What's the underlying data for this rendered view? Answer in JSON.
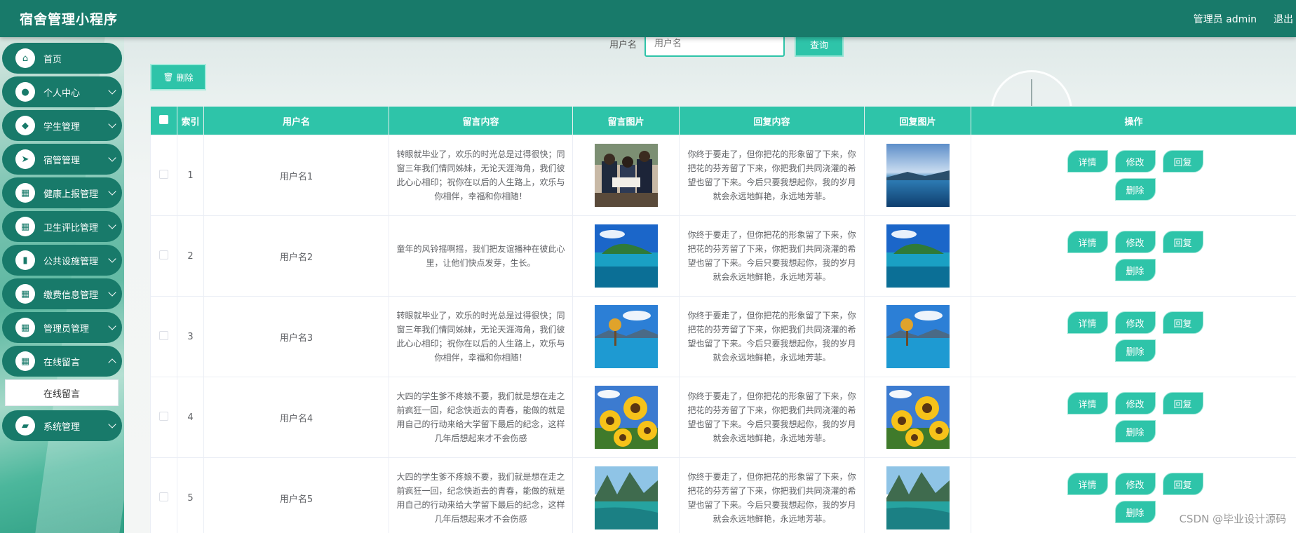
{
  "app": {
    "title": "宿舍管理小程序"
  },
  "topbar": {
    "user": "管理员 admin",
    "logout": "退出"
  },
  "sidebar": {
    "items": [
      {
        "label": "首页",
        "icon": "home-icon",
        "glyph": "⌂",
        "expandable": false
      },
      {
        "label": "个人中心",
        "icon": "user-icon",
        "glyph": "●",
        "expandable": true
      },
      {
        "label": "学生管理",
        "icon": "student-icon",
        "glyph": "◆",
        "expandable": true
      },
      {
        "label": "宿管管理",
        "icon": "send-icon",
        "glyph": "➤",
        "expandable": true
      },
      {
        "label": "健康上报管理",
        "icon": "grid-icon",
        "glyph": "▦",
        "expandable": true
      },
      {
        "label": "卫生评比管理",
        "icon": "grid-icon",
        "glyph": "▦",
        "expandable": true
      },
      {
        "label": "公共设施管理",
        "icon": "book-icon",
        "glyph": "▮",
        "expandable": true
      },
      {
        "label": "缴费信息管理",
        "icon": "grid-icon",
        "glyph": "▦",
        "expandable": true
      },
      {
        "label": "管理员管理",
        "icon": "grid-icon",
        "glyph": "▦",
        "expandable": true
      },
      {
        "label": "在线留言",
        "icon": "grid-icon",
        "glyph": "▦",
        "expandable": true,
        "open": true
      },
      {
        "label": "系统管理",
        "icon": "wallet-icon",
        "glyph": "▰",
        "expandable": true
      }
    ],
    "sub_item": "在线留言"
  },
  "search": {
    "label": "用户名",
    "placeholder": "用户名",
    "button": "查询"
  },
  "toolbar": {
    "delete_label": "删除",
    "delete_icon": "trash-icon"
  },
  "table": {
    "headers": [
      "",
      "索引",
      "用户名",
      "留言内容",
      "留言图片",
      "回复内容",
      "回复图片",
      "操作"
    ],
    "rows": [
      {
        "index": "1",
        "username": "用户名1",
        "message": "转眼就毕业了，欢乐的时光总是过得很快；同窗三年我们情同姊妹，无论天涯海角，我们彼此心心相印；祝你在以后的人生路上，欢乐与你相伴，幸福和你相随！",
        "message_image": "students-reading",
        "reply": "你终于要走了，但你把花的形象留了下来，你把花的芬芳留了下来，你把我们共同浇灌的希望也留了下来。今后只要我想起你，我的岁月就会永远地鲜艳，永远地芳菲。",
        "reply_image": "lake-sky"
      },
      {
        "index": "2",
        "username": "用户名2",
        "message": "童年的风铃摇啊摇，我们把友谊播种在彼此心里，让他们快点发芽，生长。",
        "message_image": "island-lake",
        "reply": "你终于要走了，但你把花的形象留了下来，你把花的芬芳留了下来，你把我们共同浇灌的希望也留了下来。今后只要我想起你，我的岁月就会永远地鲜艳，永远地芳菲。",
        "reply_image": "island-lake"
      },
      {
        "index": "3",
        "username": "用户名3",
        "message": "转眼就毕业了，欢乐的时光总是过得很快；同窗三年我们情同姊妹，无论天涯海角，我们彼此心心相印；祝你在以后的人生路上，欢乐与你相伴，幸福和你相随！",
        "message_image": "tree-lake",
        "reply": "你终于要走了，但你把花的形象留了下来，你把花的芬芳留了下来，你把我们共同浇灌的希望也留了下来。今后只要我想起你，我的岁月就会永远地鲜艳，永远地芳菲。",
        "reply_image": "tree-lake"
      },
      {
        "index": "4",
        "username": "用户名4",
        "message": "大四的学生爹不疼娘不要，我们就是想在走之前疯狂一回，纪念快逝去的青春，能做的就是用自己的行动来给大学留下最后的纪念，这样几年后想起来才不会伤感",
        "message_image": "sunflowers",
        "reply": "你终于要走了，但你把花的形象留了下来，你把花的芬芳留了下来，你把我们共同浇灌的希望也留了下来。今后只要我想起你，我的岁月就会永远地鲜艳，永远地芳菲。",
        "reply_image": "sunflowers"
      },
      {
        "index": "5",
        "username": "用户名5",
        "message": "大四的学生爹不疼娘不要，我们就是想在走之前疯狂一回，纪念快逝去的青春，能做的就是用自己的行动来给大学留下最后的纪念，这样几年后想起来才不会伤感",
        "message_image": "mountain-river",
        "reply": "你终于要走了，但你把花的形象留了下来，你把花的芬芳留了下来，你把我们共同浇灌的希望也留了下来。今后只要我想起你，我的岁月就会永远地鲜艳，永远地芳菲。",
        "reply_image": "mountain-river"
      }
    ],
    "actions": [
      "详情",
      "修改",
      "回复",
      "删除"
    ]
  },
  "watermark": "CSDN @毕业设计源码"
}
